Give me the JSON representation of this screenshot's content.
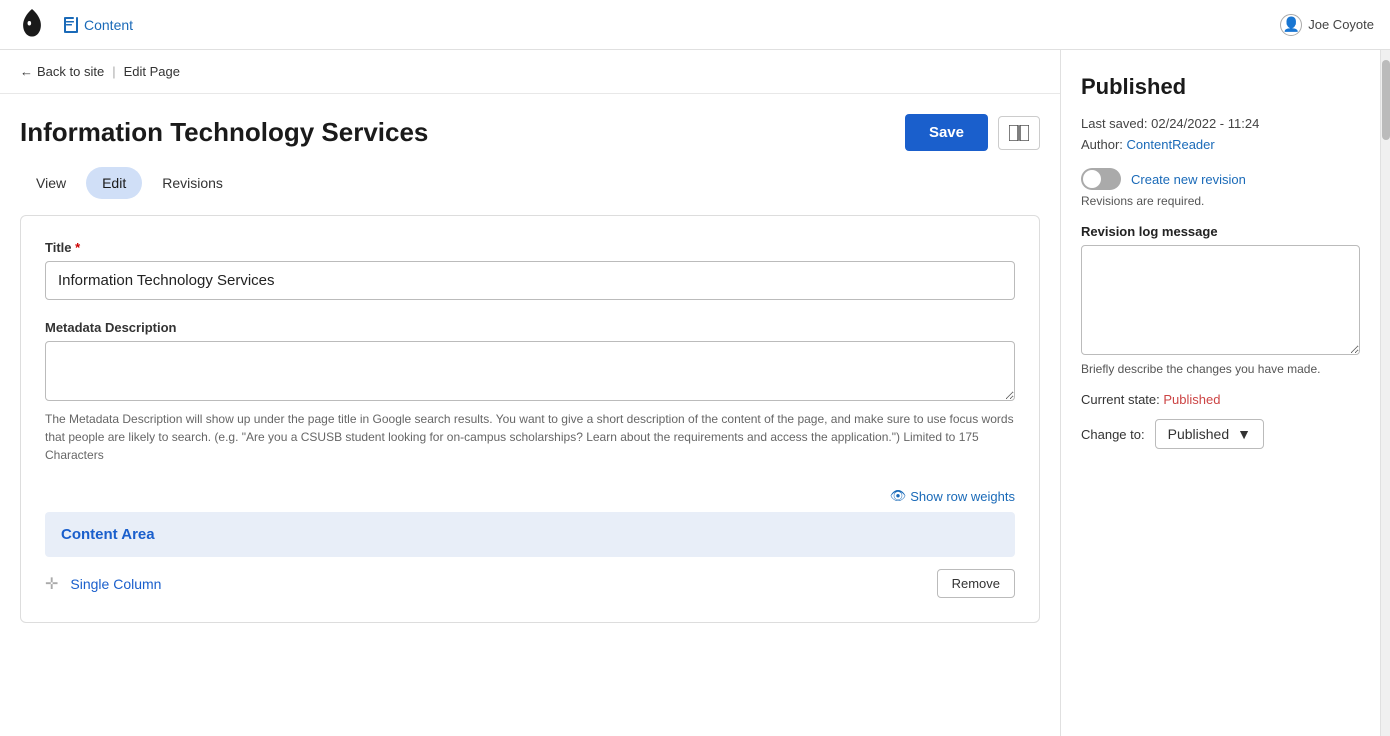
{
  "topbar": {
    "logo_alt": "Drupal drop logo",
    "content_link": "Content"
  },
  "breadcrumb": {
    "back_label": "Back to site",
    "divider": "|",
    "current_label": "Edit Page"
  },
  "page": {
    "title": "Information Technology Services",
    "save_button": "Save",
    "layout_button_title": "Layout"
  },
  "user": {
    "name": "Joe Coyote"
  },
  "tabs": [
    {
      "id": "view",
      "label": "View",
      "active": false
    },
    {
      "id": "edit",
      "label": "Edit",
      "active": true
    },
    {
      "id": "revisions",
      "label": "Revisions",
      "active": false
    }
  ],
  "form": {
    "title_label": "Title",
    "title_required": true,
    "title_value": "Information Technology Services",
    "metadata_label": "Metadata Description",
    "metadata_value": "",
    "metadata_help": "The Metadata Description will show up under the page title in Google search results. You want to give a short description of the content of the page, and make sure to use focus words that people are likely to search. (e.g. \"Are you a CSUSB student looking for on-campus scholarships? Learn about the requirements and access the application.\") Limited to 175 Characters",
    "show_row_weights_label": "Show row weights",
    "content_area_label": "Content Area",
    "single_column_label": "Single Column",
    "remove_button": "Remove"
  },
  "sidebar": {
    "status_title": "Published",
    "last_saved_label": "Last saved:",
    "last_saved_value": "02/24/2022 - 11:24",
    "author_label": "Author:",
    "author_value": "ContentReader",
    "toggle_label": "Create new revision",
    "revisions_required": "Revisions are required.",
    "revision_log_label": "Revision log message",
    "revision_log_placeholder": "",
    "revision_log_help": "Briefly describe the changes you have made.",
    "current_state_label": "Current state:",
    "current_state_value": "Published",
    "change_to_label": "Change to:",
    "change_to_value": "Published"
  }
}
